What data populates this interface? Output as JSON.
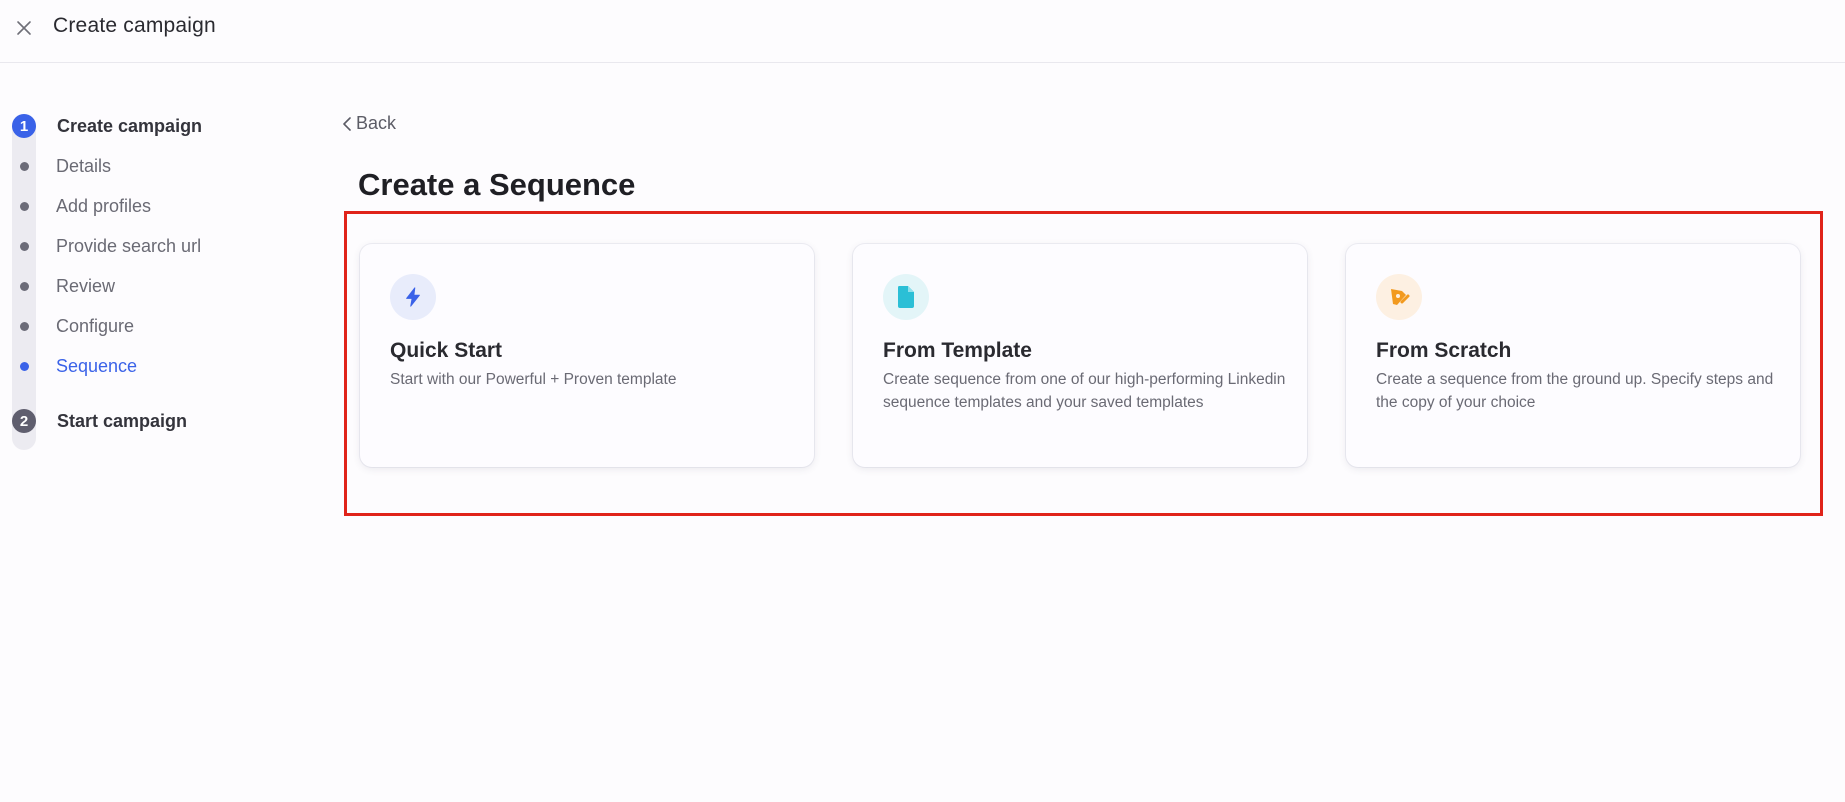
{
  "header": {
    "title": "Create campaign",
    "close_icon": "close-icon"
  },
  "stepper": {
    "steps": [
      {
        "number": "1",
        "label": "Create campaign",
        "status": "active"
      },
      {
        "number": "2",
        "label": "Start campaign",
        "status": "pending"
      }
    ],
    "substeps": [
      {
        "label": "Details",
        "active": false
      },
      {
        "label": "Add profiles",
        "active": false
      },
      {
        "label": "Provide search url",
        "active": false
      },
      {
        "label": "Review",
        "active": false
      },
      {
        "label": "Configure",
        "active": false
      },
      {
        "label": "Sequence",
        "active": true
      }
    ]
  },
  "main": {
    "back_label": "Back",
    "heading": "Create a Sequence",
    "cards": [
      {
        "icon": "lightning-icon",
        "title": "Quick Start",
        "description": "Start with our Powerful + Proven template",
        "icon_color": "#3a62e8",
        "icon_bg": "#e8ecfb"
      },
      {
        "icon": "document-icon",
        "title": "From Template",
        "description": "Create sequence from one of our high-performing Linkedin sequence templates and your saved templates",
        "icon_color": "#2bbfd6",
        "icon_bg": "#e3f5f8"
      },
      {
        "icon": "pen-tool-icon",
        "title": "From Scratch",
        "description": "Create a sequence from the ground up. Specify steps and the copy of your choice",
        "icon_color": "#f29a1f",
        "icon_bg": "#fdf0e2"
      }
    ]
  },
  "colors": {
    "accent": "#3a62e8",
    "highlight_border": "#e0231a"
  }
}
